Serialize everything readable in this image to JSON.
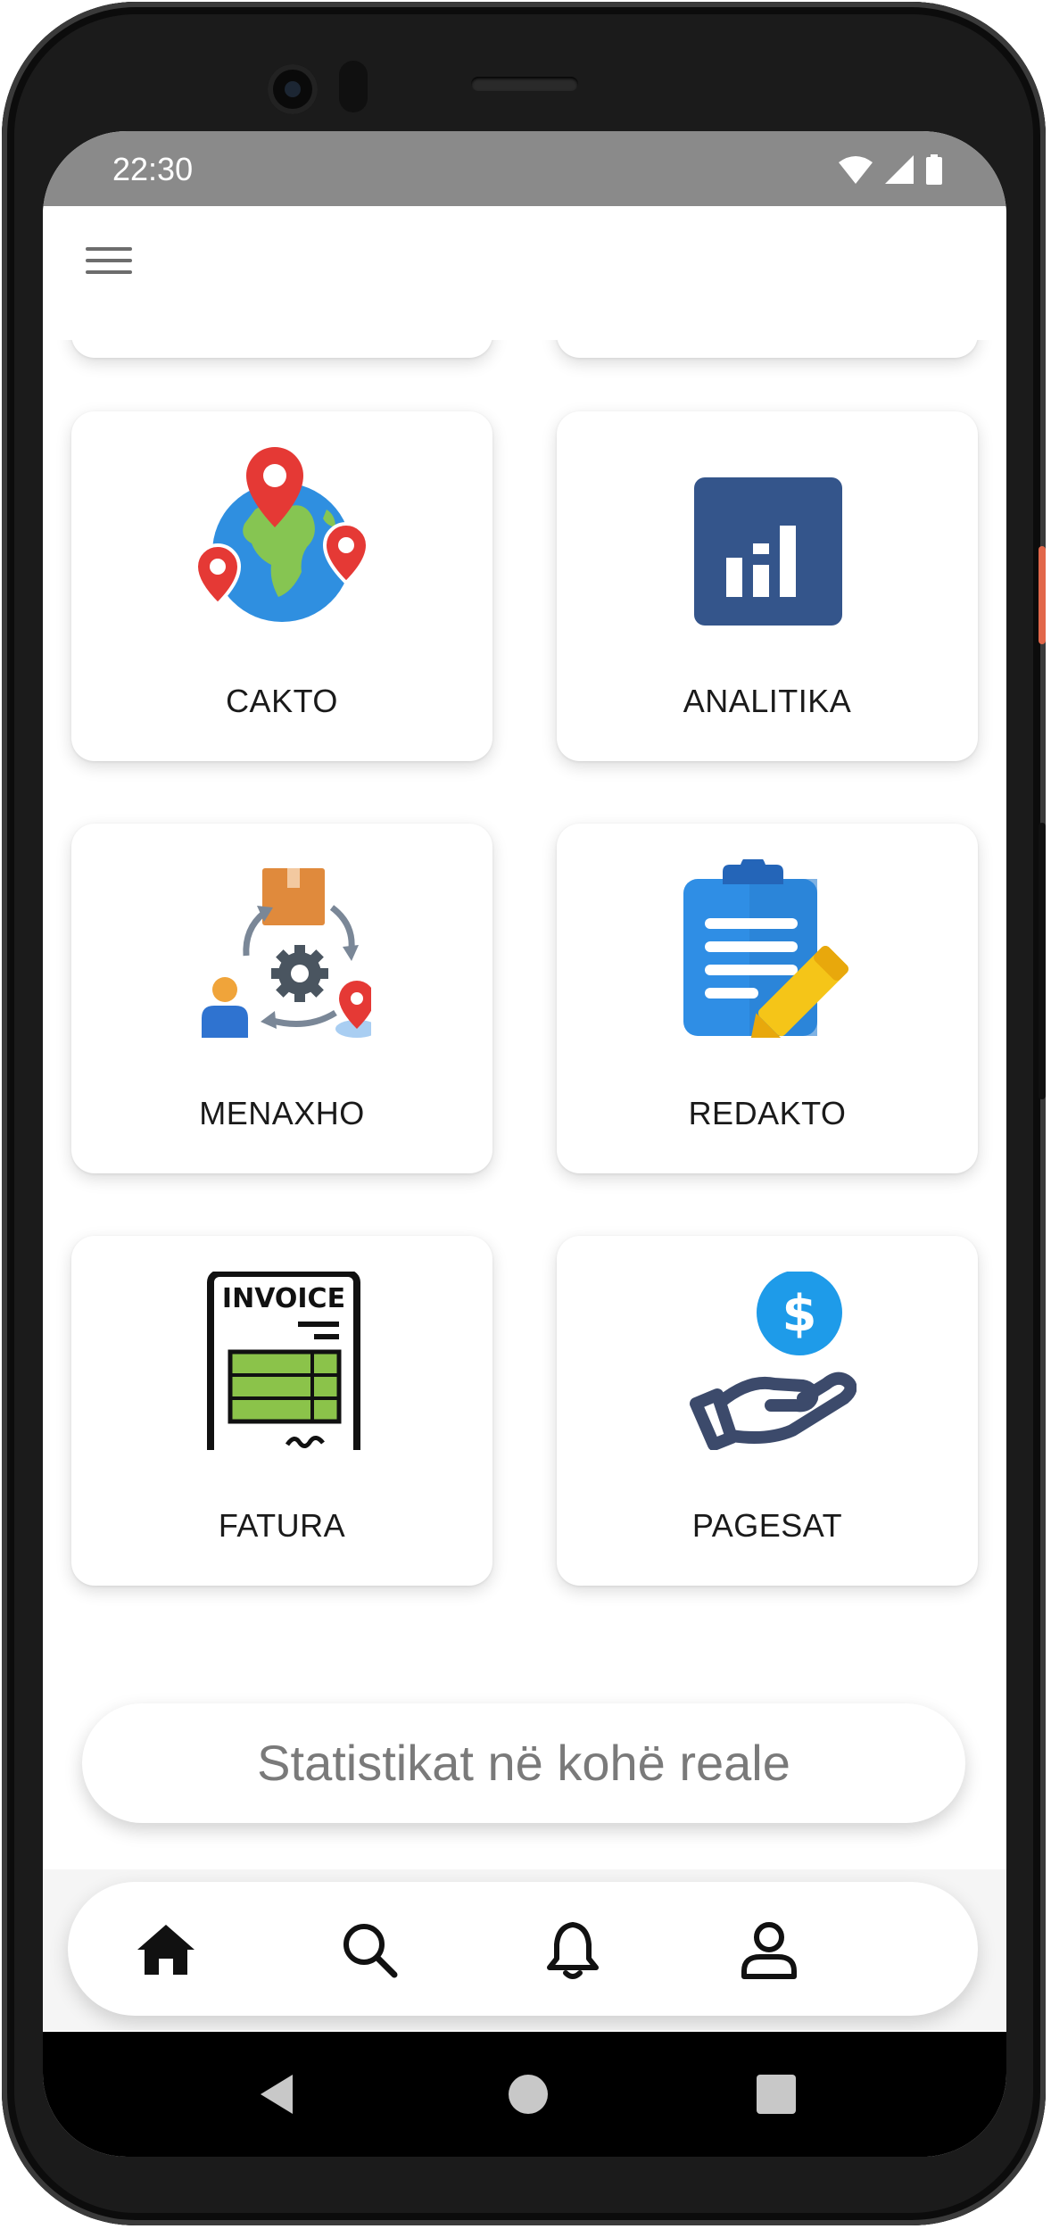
{
  "status_bar": {
    "time": "22:30"
  },
  "tiles": [
    {
      "label": "CAKTO",
      "icon": "globe-location-pins-icon"
    },
    {
      "label": "ANALITIKA",
      "icon": "bar-chart-icon"
    },
    {
      "label": "MENAXHO",
      "icon": "logistics-cycle-icon"
    },
    {
      "label": "REDAKTO",
      "icon": "clipboard-edit-icon"
    },
    {
      "label": "FATURA",
      "icon": "invoice-icon",
      "icon_text": "INVOICE"
    },
    {
      "label": "PAGESAT",
      "icon": "payment-hand-dollar-icon",
      "icon_text": "$"
    }
  ],
  "stats_button": {
    "label": "Statistikat në kohë reale"
  },
  "bottom_nav": [
    {
      "name": "home",
      "icon": "home-icon",
      "active": true
    },
    {
      "name": "search",
      "icon": "search-icon",
      "active": false
    },
    {
      "name": "notifications",
      "icon": "bell-icon",
      "active": false
    },
    {
      "name": "profile",
      "icon": "user-icon",
      "active": false
    }
  ],
  "colors": {
    "status_bar": "#8a8a8a",
    "pin_red": "#e53935",
    "analytics_blue": "#34558b",
    "clipboard_blue": "#2f8ee5",
    "pencil_yellow": "#f5c518",
    "invoice_green": "#8bc34a",
    "dollar_blue": "#1e9be9",
    "hand_navy": "#3c4a6b"
  }
}
